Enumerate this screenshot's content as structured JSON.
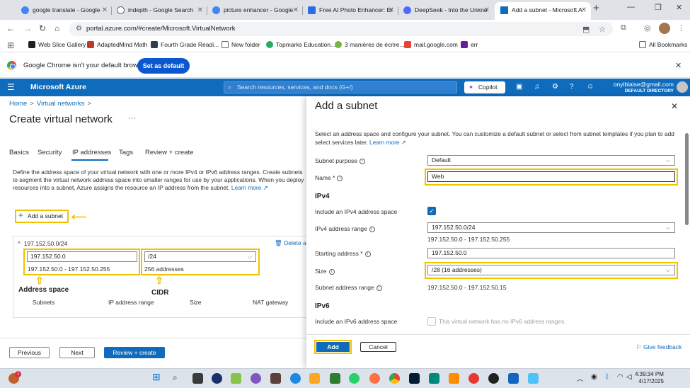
{
  "browser": {
    "tabs": [
      {
        "title": "google translate - Google",
        "color": "#4285f4"
      },
      {
        "title": "indepth - Google Search",
        "color": "#4285f4"
      },
      {
        "title": "picture enhancer - Google",
        "color": "#4285f4"
      },
      {
        "title": "Free AI Photo Enhancer: Er",
        "color": "#2b6de0"
      },
      {
        "title": "DeepSeek - Into the Unkno",
        "color": "#4d6bfe"
      },
      {
        "title": "Add a subnet - Microsoft A",
        "color": "#0f6cbd"
      }
    ],
    "url": "portal.azure.com/#create/Microsoft.VirtualNetwork",
    "bookmarks": [
      {
        "label": "Web Slice Gallery",
        "color": "#202124"
      },
      {
        "label": "AdaptedMind Math",
        "color": "#c0392b"
      },
      {
        "label": "Fourth Grade Readi...",
        "color": "#2c3e50"
      },
      {
        "label": "New folder",
        "color": "#5f6368"
      },
      {
        "label": "Topmarks Education...",
        "color": "#27ae60"
      },
      {
        "label": "3 manières de écrire...",
        "color": "#7cb342"
      },
      {
        "label": "mail.google.com",
        "color": "#ea4335"
      },
      {
        "label": "err",
        "color": "#6a1b9a"
      }
    ],
    "all_bookmarks": "All Bookmarks",
    "infobar_text": "Google Chrome isn't your default browser",
    "set_default": "Set as default"
  },
  "azure": {
    "brand": "Microsoft Azure",
    "search_placeholder": "Search resources, services, and docs (G+/)",
    "copilot": "Copilot",
    "user_email": "onyiblaise@gmail.com",
    "user_directory": "DEFAULT DIRECTORY"
  },
  "blade": {
    "breadcrumb": [
      "Home",
      "Virtual networks"
    ],
    "title": "Create virtual network",
    "tabs": [
      "Basics",
      "Security",
      "IP addresses",
      "Tags",
      "Review + create"
    ],
    "description": "Define the address space of your virtual network with one or more IPv4 or IPv6 address ranges. Create subnets to segment the virtual network address space into smaller ranges for use by your applications. When you deploy resources into a subnet, Azure assigns the resource an IP address from the subnet.",
    "learn_more": "Learn more",
    "add_subnet": "Add a subnet",
    "address_space_header": "197.152.50.0/24",
    "delete_link": "Delete ac",
    "address_value": "197.152.50.0",
    "address_range": "197.152.50.0 - 197.152.50.255",
    "cidr_value": "/24",
    "cidr_count": "256 addresses",
    "annotation_address_space": "Address space",
    "annotation_cidr": "CIDR",
    "columns": [
      "Subnets",
      "IP address range",
      "Size",
      "NAT gateway"
    ],
    "buttons": {
      "previous": "Previous",
      "next": "Next",
      "review": "Review + create"
    }
  },
  "panel": {
    "title": "Add a subnet",
    "description": "Select an address space and configure your subnet. You can customize a default subnet or select from subnet templates if you plan to add select services later.",
    "learn_more": "Learn more",
    "subnet_purpose_label": "Subnet purpose",
    "subnet_purpose_value": "Default",
    "name_label": "Name *",
    "name_value": "Web",
    "ipv4_header": "IPv4",
    "include_ipv4_label": "Include an IPv4 address space",
    "ipv4_range_label": "IPv4 address range",
    "ipv4_range_value": "197.152.50.0/24",
    "ipv4_range_text": "197.152.50.0 - 197.152.50.255",
    "starting_label": "Starting address *",
    "starting_value": "197.152.50.0",
    "size_label": "Size",
    "size_value": "/28 (16 addresses)",
    "subnet_range_label": "Subnet address range",
    "subnet_range_value": "197.152.50.0 - 197.152.50.15",
    "ipv6_header": "IPv6",
    "include_ipv6_label": "Include an IPv6 address space",
    "ipv6_disabled_text": "This virtual network has no IPv6 address ranges.",
    "add": "Add",
    "cancel": "Cancel",
    "feedback": "Give feedback"
  },
  "taskbar": {
    "time": "4:39:34 PM",
    "date": "4/17/2025",
    "notification_count": "1"
  }
}
